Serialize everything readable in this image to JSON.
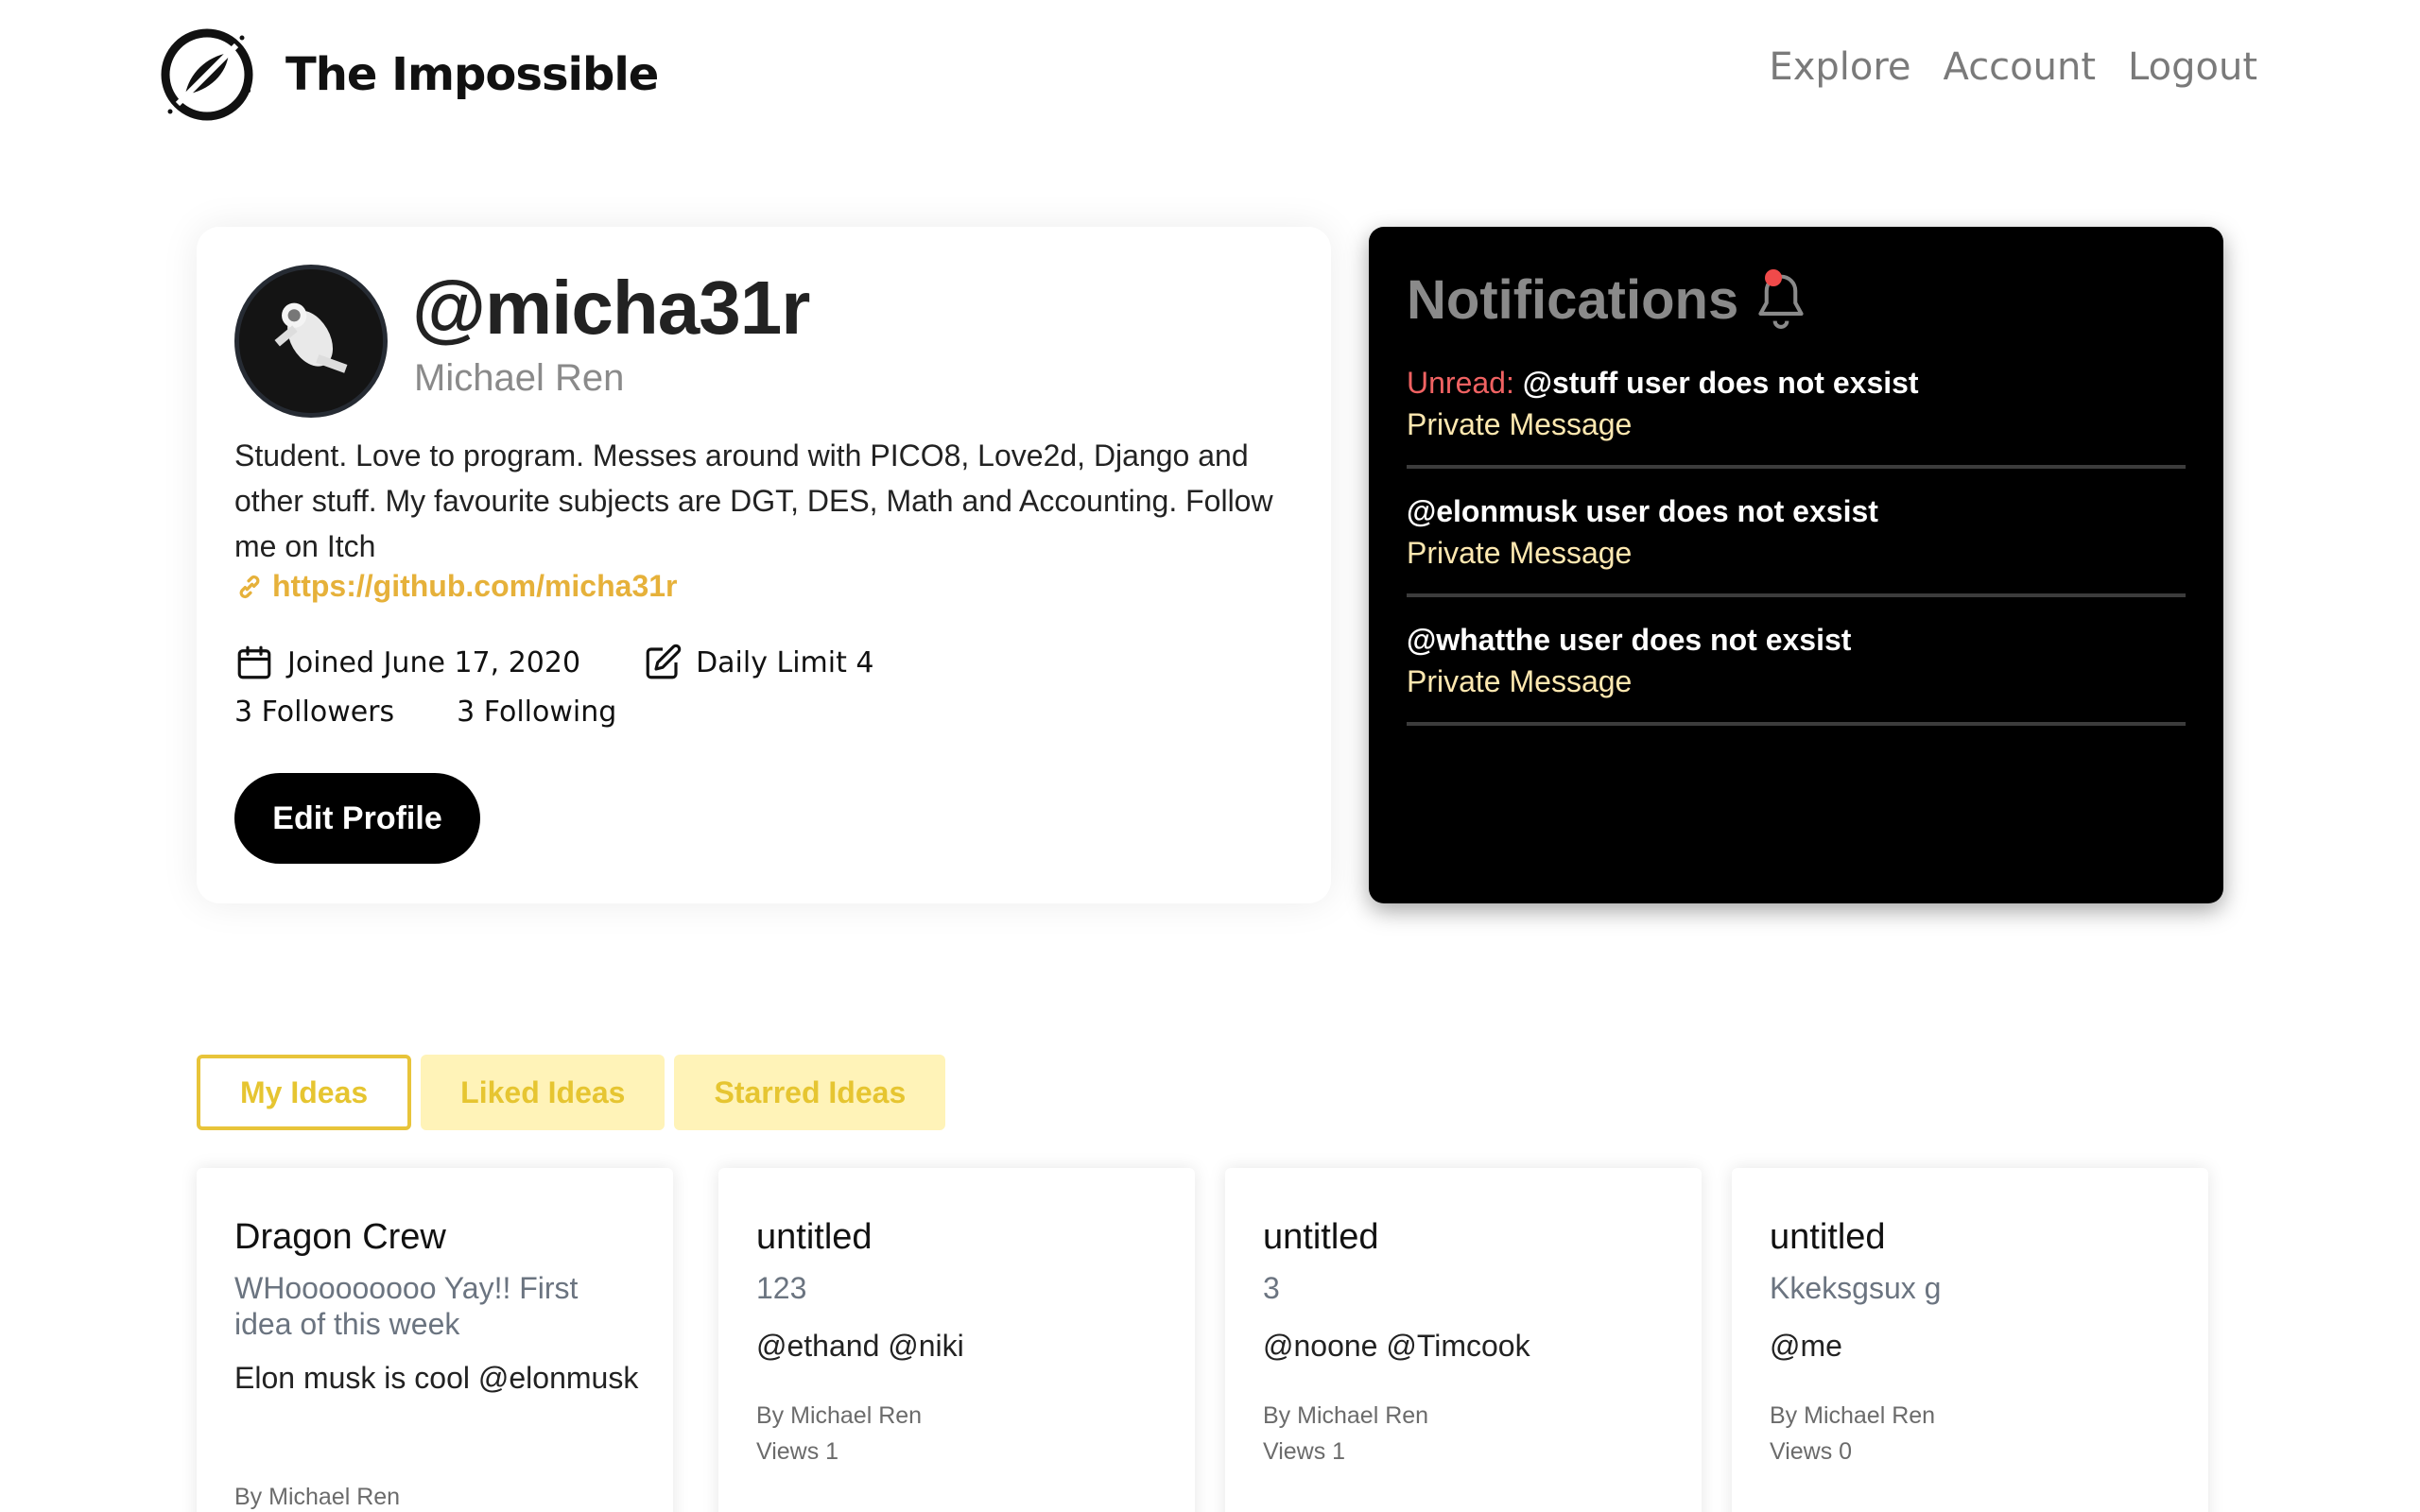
{
  "header": {
    "brand": "The Impossible",
    "nav": [
      "Explore",
      "Account",
      "Logout"
    ]
  },
  "profile": {
    "username": "@micha31r",
    "full_name": "Michael Ren",
    "bio": "Student. Love to program. Messes around with PICO8, Love2d, Django and other stuff. My favourite subjects are DGT, DES, Math and Accounting. Follow me on Itch",
    "link": "https://github.com/micha31r",
    "joined": "Joined June 17, 2020",
    "daily_limit": "Daily Limit 4",
    "followers": "3 Followers",
    "following": "3 Following",
    "edit_button": "Edit Profile"
  },
  "notifications": {
    "title": "Notifications",
    "items": [
      {
        "unread_label": "Unread: ",
        "message": "@stuff user does not exsist",
        "type": "Private Message"
      },
      {
        "unread_label": "",
        "message": "@elonmusk user does not exsist",
        "type": "Private Message"
      },
      {
        "unread_label": "",
        "message": "@whatthe user does not exsist",
        "type": "Private Message"
      }
    ]
  },
  "tabs": [
    "My Ideas",
    "Liked Ideas",
    "Starred Ideas"
  ],
  "ideas": [
    {
      "title": "Dragon Crew",
      "subtitle": "WHooooooooo Yay!! First idea of this week",
      "body": "Elon musk is cool @elonmusk",
      "by": "By Michael Ren",
      "views": ""
    },
    {
      "title": "untitled",
      "subtitle": "123",
      "body": "@ethand @niki",
      "by": "By Michael Ren",
      "views": "Views 1"
    },
    {
      "title": "untitled",
      "subtitle": "3",
      "body": "@noone @Timcook",
      "by": "By Michael Ren",
      "views": "Views 1"
    },
    {
      "title": "untitled",
      "subtitle": "Kkeksgsux g",
      "body": "@me",
      "by": "By Michael Ren",
      "views": "Views 0"
    }
  ],
  "colors": {
    "accent": "#e6b13a",
    "tab_yellow": "#e6c531",
    "unread": "#f06262",
    "notif_bg": "#000000"
  }
}
